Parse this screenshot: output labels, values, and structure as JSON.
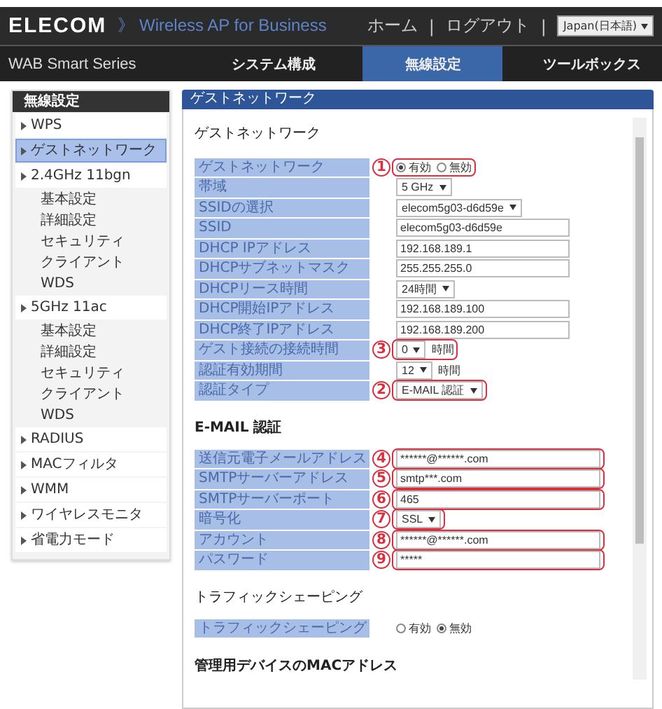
{
  "header": {
    "logo": "ELECOM",
    "product": "》 Wireless AP for Business",
    "links": [
      "ホーム",
      "ログアウト"
    ],
    "separator": "|",
    "language": "Japan(日本語)"
  },
  "nav": {
    "series": "WAB Smart Series",
    "tabs": [
      {
        "label": "システム構成",
        "selected": false
      },
      {
        "label": "無線設定",
        "selected": true
      },
      {
        "label": "ツールボックス",
        "selected": false
      }
    ]
  },
  "sidebar": {
    "title": "無線設定",
    "items": [
      {
        "label": "WPS",
        "selected": false
      },
      {
        "label": "ゲストネットワーク",
        "selected": true
      },
      {
        "label": "2.4GHz 11bgn",
        "selected": false,
        "children": [
          {
            "label": "基本設定",
            "selected": false
          },
          {
            "label": "詳細設定",
            "selected": false
          },
          {
            "label": "セキュリティ",
            "selected": false
          },
          {
            "label": "クライアント",
            "selected": false
          },
          {
            "label": "WDS",
            "selected": false
          }
        ]
      },
      {
        "label": "5GHz 11ac",
        "selected": false,
        "children": [
          {
            "label": "基本設定",
            "selected": false
          },
          {
            "label": "詳細設定",
            "selected": false
          },
          {
            "label": "セキュリティ",
            "selected": false
          },
          {
            "label": "クライアント",
            "selected": false
          },
          {
            "label": "WDS",
            "selected": false
          }
        ]
      },
      {
        "label": "RADIUS",
        "selected": false
      },
      {
        "label": "MACフィルタ",
        "selected": false
      },
      {
        "label": "WMM",
        "selected": false
      },
      {
        "label": "ワイヤレスモニタ",
        "selected": false
      },
      {
        "label": "省電力モード",
        "selected": false
      }
    ]
  },
  "main": {
    "title": "ゲストネットワーク",
    "sections": [
      {
        "heading": "ゲストネットワーク",
        "rows": [
          {
            "label": "ゲストネットワーク",
            "kind": "radio",
            "annotation": "1",
            "options": [
              {
                "label": "有効",
                "selected": true
              },
              {
                "label": "無効",
                "selected": false
              }
            ]
          },
          {
            "label": "帯域",
            "kind": "select",
            "value": "5 GHz"
          },
          {
            "label": "SSIDの選択",
            "kind": "select",
            "value": "elecom5g03-d6d59e"
          },
          {
            "label": "SSID",
            "kind": "input",
            "value": "elecom5g03-d6d59e"
          },
          {
            "label": "DHCP IPアドレス",
            "kind": "input",
            "value": "192.168.189.1"
          },
          {
            "label": "DHCPサブネットマスク",
            "kind": "input",
            "value": "255.255.255.0"
          },
          {
            "label": "DHCPリース時間",
            "kind": "select",
            "value": "24時間"
          },
          {
            "label": "DHCP開始IPアドレス",
            "kind": "input",
            "value": "192.168.189.100"
          },
          {
            "label": "DHCP終了IPアドレス",
            "kind": "input",
            "value": "192.168.189.200"
          },
          {
            "label": "ゲスト接続の接続時間",
            "kind": "select",
            "annotation": "3",
            "value": "0",
            "unit": "時間"
          },
          {
            "label": "認証有効期間",
            "kind": "select",
            "value": "12",
            "unit": "時間"
          },
          {
            "label": "認証タイプ",
            "kind": "select",
            "annotation": "2",
            "value": "E-MAIL 認証"
          }
        ]
      },
      {
        "heading": "E-MAIL 認証",
        "rows": [
          {
            "label": "送信元電子メールアドレス",
            "kind": "input",
            "annotation": "4",
            "value": "******@******.com"
          },
          {
            "label": "SMTPサーバーアドレス",
            "kind": "input",
            "annotation": "5",
            "value": "smtp***.com"
          },
          {
            "label": "SMTPサーバーポート",
            "kind": "input",
            "annotation": "6",
            "value": "465"
          },
          {
            "label": "暗号化",
            "kind": "select",
            "annotation": "7",
            "value": "SSL"
          },
          {
            "label": "アカウント",
            "kind": "input",
            "annotation": "8",
            "value": "******@******.com"
          },
          {
            "label": "パスワード",
            "kind": "input",
            "annotation": "9",
            "value": "*****"
          }
        ]
      },
      {
        "heading": "トラフィックシェーピング",
        "rows": [
          {
            "label": "トラフィックシェーピング",
            "kind": "radio",
            "options": [
              {
                "label": "有効",
                "selected": false
              },
              {
                "label": "無効",
                "selected": true
              }
            ]
          }
        ]
      },
      {
        "heading": "管理用デバイスのMACアドレス"
      }
    ]
  }
}
